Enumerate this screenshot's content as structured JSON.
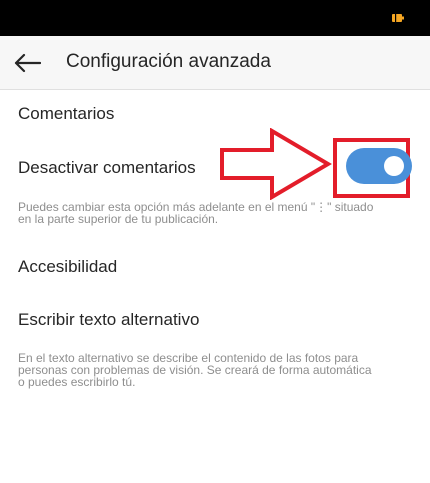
{
  "status_bar": {
    "battery_icon": "battery-icon",
    "battery_color": "#f5a623"
  },
  "app_bar": {
    "back_icon": "arrow-left-icon",
    "title": "Configuración avanzada"
  },
  "comments_section": {
    "heading": "Comentarios",
    "toggle_label": "Desactivar comentarios",
    "toggle_on": true,
    "caption_lines": [
      "Puedes cambiar esta opción más adelante en el menú \"⋮\" situado",
      "en la parte superior de tu publicación."
    ]
  },
  "accessibility_section": {
    "heading": "Accesibilidad",
    "alt_text_label": "Escribir texto alternativo",
    "caption_lines": [
      "En el texto alternativo se describe el contenido de las fotos para",
      "personas con problemas de visión. Se creará de forma automática",
      "o puedes escribirlo tú."
    ]
  },
  "annotation": {
    "color": "#e31d2a",
    "arrow_icon": "red-arrow-icon",
    "highlight": "highlight-box"
  },
  "colors": {
    "toggle_on": "#4a90d9",
    "text_primary": "#262626",
    "text_secondary": "#8e8e8e"
  }
}
